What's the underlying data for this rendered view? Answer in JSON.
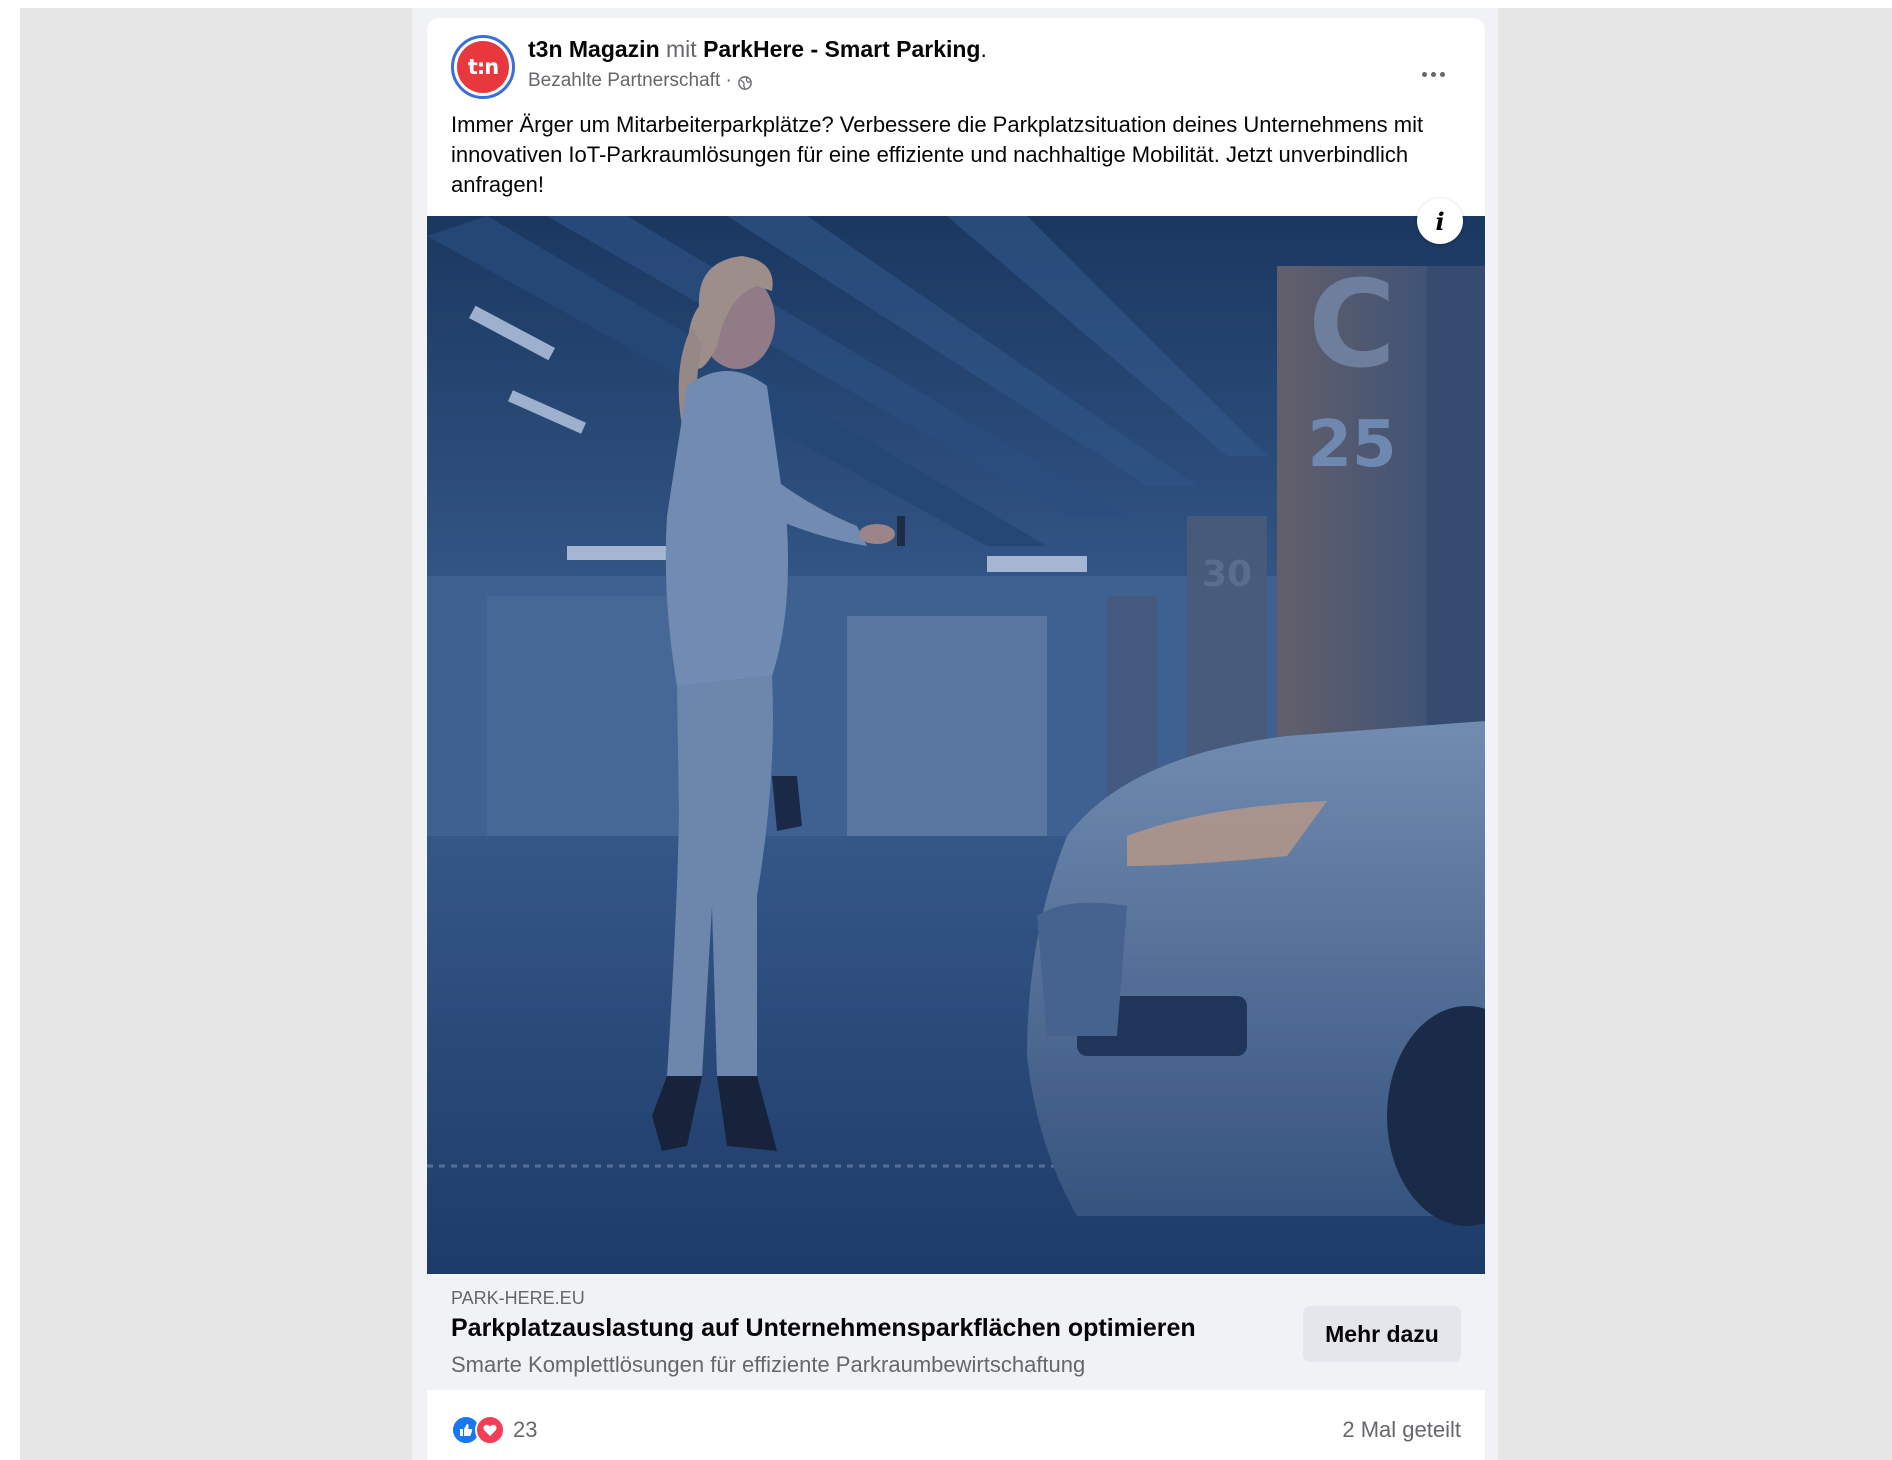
{
  "post": {
    "page_name": "t3n Magazin",
    "connector": "mit",
    "partner_name": "ParkHere - Smart Parking",
    "period": ".",
    "subtitle": "Bezahlte Partnerschaft ·",
    "avatar_text": "t:n",
    "privacy_icon": "globe-icon",
    "more_icon": "more-options-icon",
    "body_text": "Immer Ärger um Mitarbeiterparkplätze? Verbessere die Parkplatzsituation deines Unternehmens mit innovativen IoT-Parkraumlösungen für eine effiziente und nachhaltige Mobilität. Jetzt unverbindlich anfragen!"
  },
  "ad_image": {
    "info_label": "i",
    "pillar_letter": "C",
    "pillar_number": "25",
    "pillar_number_small": "30"
  },
  "link_preview": {
    "domain": "PARK-HERE.EU",
    "headline": "Parkplatzauslastung auf Unternehmensparkflächen optimieren",
    "description": "Smarte Komplettlösungen für effiziente Parkraumbewirtschaftung",
    "cta_label": "Mehr dazu"
  },
  "engagement": {
    "reactions": [
      "like-icon",
      "love-icon"
    ],
    "reaction_count": "23",
    "shares": "2 Mal geteilt"
  },
  "colors": {
    "accent": "#1877f2",
    "love": "#f33e58",
    "brand_red": "#e8383d",
    "image_tint": "#1f4273"
  }
}
